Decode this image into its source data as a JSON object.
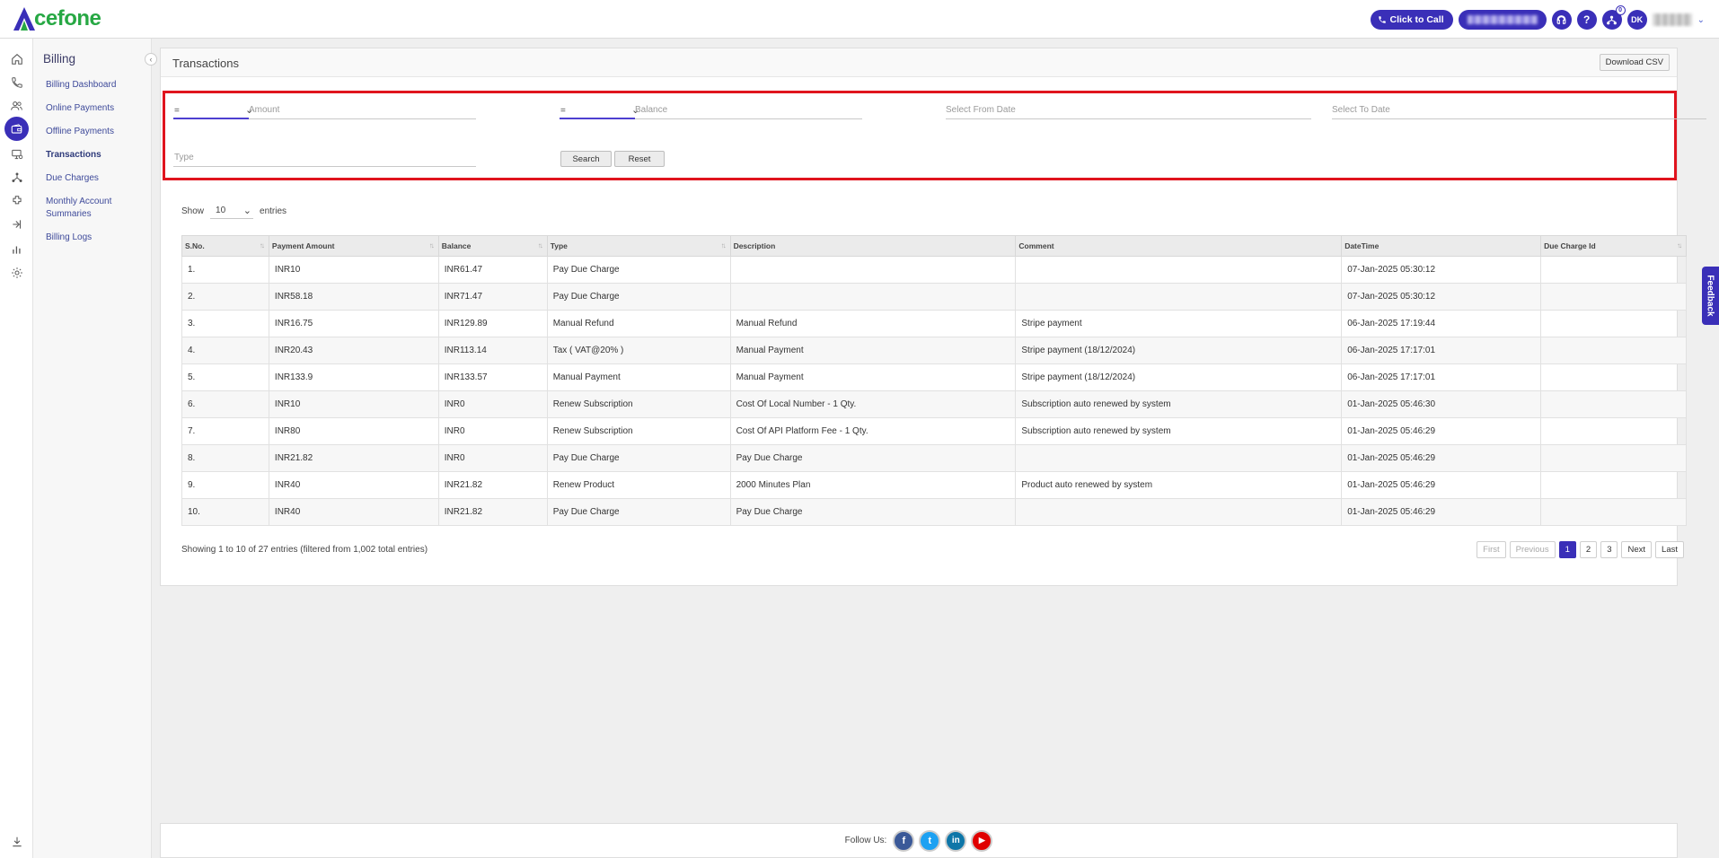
{
  "brand": {
    "logo_text": "cefone",
    "logo_letter": "A"
  },
  "topbar": {
    "click_to_call_label": "Click to Call",
    "notification_count": "0",
    "user_initials": "DK"
  },
  "subnav": {
    "title": "Billing",
    "items": [
      {
        "label": "Billing Dashboard"
      },
      {
        "label": "Online Payments"
      },
      {
        "label": "Offline Payments"
      },
      {
        "label": "Transactions"
      },
      {
        "label": "Due Charges"
      },
      {
        "label": "Monthly Account Summaries"
      },
      {
        "label": "Billing Logs"
      }
    ]
  },
  "panel": {
    "title": "Transactions",
    "download_label": "Download CSV"
  },
  "filters": {
    "amount_operator": "=",
    "amount_placeholder": "Amount",
    "balance_operator": "=",
    "balance_placeholder": "Balance",
    "from_date_placeholder": "Select From Date",
    "to_date_placeholder": "Select To Date",
    "type_placeholder": "Type",
    "search_label": "Search",
    "reset_label": "Reset"
  },
  "length": {
    "show": "Show",
    "value": "10",
    "entries": "entries"
  },
  "table": {
    "columns": [
      "S.No.",
      "Payment Amount",
      "Balance",
      "Type",
      "Description",
      "Comment",
      "DateTime",
      "Due Charge Id"
    ],
    "rows": [
      [
        "1.",
        "INR10",
        "INR61.47",
        "Pay Due Charge",
        "",
        "",
        "07-Jan-2025 05:30:12",
        ""
      ],
      [
        "2.",
        "INR58.18",
        "INR71.47",
        "Pay Due Charge",
        "",
        "",
        "07-Jan-2025 05:30:12",
        ""
      ],
      [
        "3.",
        "INR16.75",
        "INR129.89",
        "Manual Refund",
        "Manual Refund",
        "Stripe payment",
        "06-Jan-2025 17:19:44",
        ""
      ],
      [
        "4.",
        "INR20.43",
        "INR113.14",
        "Tax ( VAT@20% )",
        "Manual Payment",
        "Stripe payment (18/12/2024)",
        "06-Jan-2025 17:17:01",
        ""
      ],
      [
        "5.",
        "INR133.9",
        "INR133.57",
        "Manual Payment",
        "Manual Payment",
        "Stripe payment (18/12/2024)",
        "06-Jan-2025 17:17:01",
        ""
      ],
      [
        "6.",
        "INR10",
        "INR0",
        "Renew Subscription",
        "Cost Of Local Number - 1 Qty.",
        "Subscription auto renewed by system",
        "01-Jan-2025 05:46:30",
        ""
      ],
      [
        "7.",
        "INR80",
        "INR0",
        "Renew Subscription",
        "Cost Of API Platform Fee - 1 Qty.",
        "Subscription auto renewed by system",
        "01-Jan-2025 05:46:29",
        ""
      ],
      [
        "8.",
        "INR21.82",
        "INR0",
        "Pay Due Charge",
        "Pay Due Charge",
        "",
        "01-Jan-2025 05:46:29",
        ""
      ],
      [
        "9.",
        "INR40",
        "INR21.82",
        "Renew Product",
        "2000 Minutes Plan",
        "Product auto renewed by system",
        "01-Jan-2025 05:46:29",
        ""
      ],
      [
        "10.",
        "INR40",
        "INR21.82",
        "Pay Due Charge",
        "Pay Due Charge",
        "",
        "01-Jan-2025 05:46:29",
        ""
      ]
    ]
  },
  "info": "Showing 1 to 10 of 27 entries (filtered from 1,002 total entries)",
  "pagination": {
    "first": "First",
    "previous": "Previous",
    "pages": [
      "1",
      "2",
      "3"
    ],
    "next": "Next",
    "last": "Last",
    "current": "1"
  },
  "footer": {
    "follow_label": "Follow Us:",
    "socials": [
      {
        "name": "facebook",
        "glyph": "f",
        "color": "#3b5998"
      },
      {
        "name": "twitter",
        "glyph": "t",
        "color": "#1da1f2"
      },
      {
        "name": "linkedin",
        "glyph": "in",
        "color": "#0e76a8"
      },
      {
        "name": "youtube",
        "glyph": "▶",
        "color": "#e00000"
      }
    ]
  },
  "feedback_label": "Feedback",
  "colors": {
    "brand_purple": "#3a2fb8",
    "brand_green": "#27a844",
    "highlight_red": "#e0141e"
  }
}
